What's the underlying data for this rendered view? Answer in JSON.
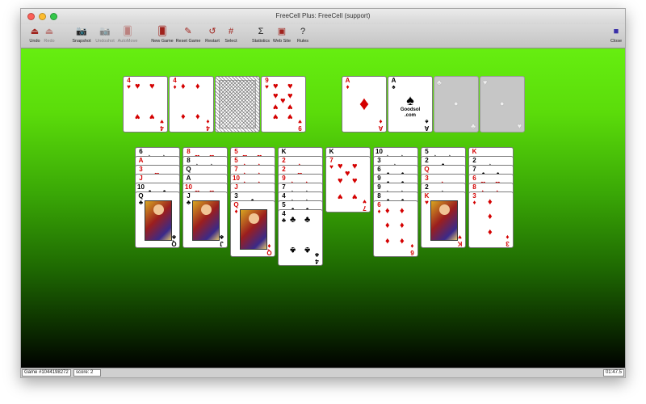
{
  "window": {
    "title": "FreeCell Plus: FreeCell (support)"
  },
  "toolbar": {
    "buttons": [
      {
        "label": "Undo",
        "icon": "undo-icon",
        "glyph": "⏏",
        "enabled": true
      },
      {
        "label": "Redo",
        "icon": "redo-icon",
        "glyph": "⏏",
        "enabled": false
      },
      {
        "label": "Snapshot",
        "icon": "snapshot-icon",
        "glyph": "📷",
        "enabled": true
      },
      {
        "label": "Undoshot",
        "icon": "undoshot-icon",
        "glyph": "📷",
        "enabled": false
      },
      {
        "label": "AutoMove",
        "icon": "automove-icon",
        "glyph": "🂠",
        "enabled": false
      },
      {
        "label": "New Game",
        "icon": "new-game-icon",
        "glyph": "🂠",
        "enabled": true
      },
      {
        "label": "Reset Game",
        "icon": "reset-game-icon",
        "glyph": "✎",
        "enabled": true
      },
      {
        "label": "Restart",
        "icon": "restart-icon",
        "glyph": "↺",
        "enabled": true
      },
      {
        "label": "Select",
        "icon": "select-icon",
        "glyph": "#",
        "enabled": true
      },
      {
        "label": "Statistics",
        "icon": "statistics-icon",
        "glyph": "Σ",
        "enabled": true
      },
      {
        "label": "Web Site",
        "icon": "web-site-icon",
        "glyph": "▣",
        "enabled": true
      },
      {
        "label": "Rules",
        "icon": "rules-icon",
        "glyph": "?",
        "enabled": true
      },
      {
        "label": "Close",
        "icon": "close-icon",
        "glyph": "■",
        "enabled": true
      }
    ]
  },
  "freecells": [
    {
      "rank": "4",
      "suit": "♥",
      "color": "red"
    },
    {
      "rank": "4",
      "suit": "♦",
      "color": "red"
    },
    {
      "back": true
    },
    {
      "rank": "9",
      "suit": "♥",
      "color": "red"
    }
  ],
  "foundations": [
    {
      "rank": "A",
      "suit": "♦",
      "color": "red"
    },
    {
      "rank": "A",
      "suit": "♠",
      "color": "blk",
      "logo": "Goodsol\n.com",
      "logo_line1": "Goodsol",
      "logo_line2": ".com"
    },
    {
      "empty": true,
      "suit": "♣"
    },
    {
      "empty": true,
      "suit": "♥"
    }
  ],
  "tableau": [
    [
      {
        "rank": "6",
        "suit": "♠",
        "color": "blk"
      },
      {
        "rank": "A",
        "suit": "♥",
        "color": "red"
      },
      {
        "rank": "3",
        "suit": "♥",
        "color": "red"
      },
      {
        "rank": "J",
        "suit": "♥",
        "color": "red"
      },
      {
        "rank": "10",
        "suit": "♣",
        "color": "blk"
      },
      {
        "rank": "Q",
        "suit": "♣",
        "color": "blk"
      }
    ],
    [
      {
        "rank": "8",
        "suit": "♥",
        "color": "red"
      },
      {
        "rank": "8",
        "suit": "♠",
        "color": "blk"
      },
      {
        "rank": "Q",
        "suit": "♠",
        "color": "blk"
      },
      {
        "rank": "A",
        "suit": "♣",
        "color": "blk"
      },
      {
        "rank": "10",
        "suit": "♥",
        "color": "red"
      },
      {
        "rank": "J",
        "suit": "♣",
        "color": "blk"
      }
    ],
    [
      {
        "rank": "5",
        "suit": "♥",
        "color": "red"
      },
      {
        "rank": "5",
        "suit": "♦",
        "color": "red"
      },
      {
        "rank": "7",
        "suit": "♦",
        "color": "red"
      },
      {
        "rank": "10",
        "suit": "♦",
        "color": "red"
      },
      {
        "rank": "J",
        "suit": "♦",
        "color": "red"
      },
      {
        "rank": "3",
        "suit": "♣",
        "color": "blk"
      },
      {
        "rank": "Q",
        "suit": "♦",
        "color": "red"
      }
    ],
    [
      {
        "rank": "K",
        "suit": "♠",
        "color": "blk"
      },
      {
        "rank": "2",
        "suit": "♦",
        "color": "red"
      },
      {
        "rank": "2",
        "suit": "♥",
        "color": "red"
      },
      {
        "rank": "9",
        "suit": "♦",
        "color": "red"
      },
      {
        "rank": "7",
        "suit": "♠",
        "color": "blk"
      },
      {
        "rank": "4",
        "suit": "♠",
        "color": "blk"
      },
      {
        "rank": "5",
        "suit": "♣",
        "color": "blk"
      },
      {
        "rank": "4",
        "suit": "♣",
        "color": "blk"
      }
    ],
    [
      {
        "rank": "K",
        "suit": "♠",
        "color": "blk"
      },
      {
        "rank": "7",
        "suit": "♥",
        "color": "red"
      }
    ],
    [
      {
        "rank": "10",
        "suit": "♠",
        "color": "blk"
      },
      {
        "rank": "3",
        "suit": "♠",
        "color": "blk"
      },
      {
        "rank": "6",
        "suit": "♣",
        "color": "blk"
      },
      {
        "rank": "9",
        "suit": "♣",
        "color": "blk"
      },
      {
        "rank": "9",
        "suit": "♠",
        "color": "blk"
      },
      {
        "rank": "8",
        "suit": "♣",
        "color": "blk"
      },
      {
        "rank": "6",
        "suit": "♦",
        "color": "red"
      }
    ],
    [
      {
        "rank": "5",
        "suit": "♠",
        "color": "blk"
      },
      {
        "rank": "2",
        "suit": "♣",
        "color": "blk"
      },
      {
        "rank": "Q",
        "suit": "♥",
        "color": "red"
      },
      {
        "rank": "3",
        "suit": "♦",
        "color": "red"
      },
      {
        "rank": "2",
        "suit": "♠",
        "color": "blk"
      },
      {
        "rank": "K",
        "suit": "♥",
        "color": "red"
      }
    ],
    [
      {
        "rank": "K",
        "suit": "♦",
        "color": "red"
      },
      {
        "rank": "2",
        "suit": "♠",
        "color": "blk"
      },
      {
        "rank": "7",
        "suit": "♣",
        "color": "blk"
      },
      {
        "rank": "6",
        "suit": "♥",
        "color": "red"
      },
      {
        "rank": "8",
        "suit": "♦",
        "color": "red"
      },
      {
        "rank": "3",
        "suit": "♦",
        "color": "red"
      }
    ]
  ],
  "status": {
    "game": "Game #1044198272",
    "score": "score: 2",
    "time": "01:47.5"
  }
}
